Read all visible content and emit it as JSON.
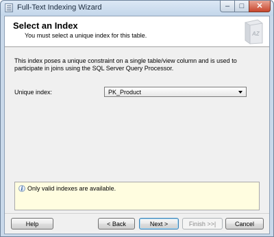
{
  "window": {
    "title": "Full-Text Indexing Wizard",
    "controls": {
      "minimize": "–",
      "maximize": "□",
      "close": "✕"
    }
  },
  "header": {
    "title": "Select an Index",
    "subtitle": "You must select a unique index for this table.",
    "icon": "book-az-icon"
  },
  "description": "This index poses a unique constraint on a single table/view column and is used to participate in joins using the SQL Server Query Processor.",
  "unique_index": {
    "label": "Unique index:",
    "selected": "PK_Product"
  },
  "message": {
    "icon": "info-icon",
    "text": "Only valid indexes are available."
  },
  "buttons": {
    "help": "Help",
    "back": "< Back",
    "next": "Next >",
    "finish": "Finish >>|",
    "cancel": "Cancel"
  }
}
